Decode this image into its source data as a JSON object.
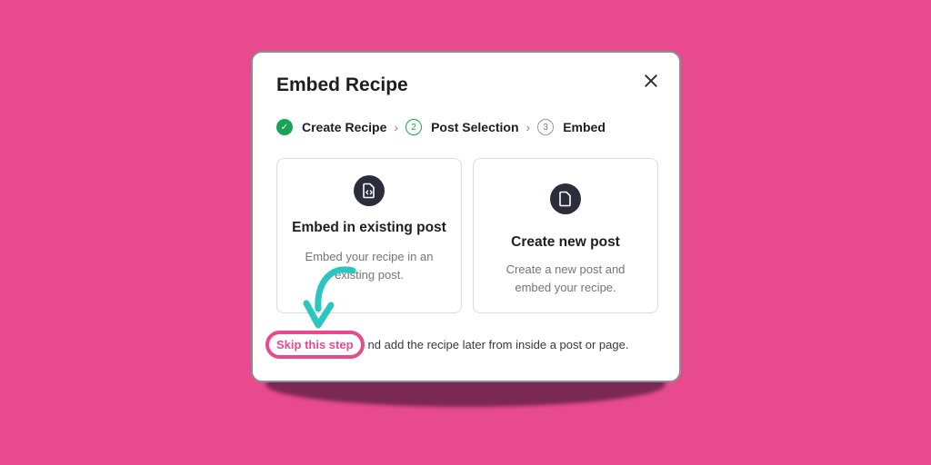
{
  "modal": {
    "title": "Embed Recipe"
  },
  "steps": [
    {
      "label": "Create Recipe",
      "state": "done",
      "number": "✓"
    },
    {
      "label": "Post Selection",
      "state": "active",
      "number": "2"
    },
    {
      "label": "Embed",
      "state": "inactive",
      "number": "3"
    }
  ],
  "separator": "›",
  "cards": {
    "existing": {
      "title": "Embed in existing post",
      "description": "Embed your recipe in an existing post."
    },
    "new_post": {
      "title": "Create new post",
      "description": "Create a new post and embed your recipe."
    }
  },
  "footer": {
    "skip_label": "Skip this step",
    "rest_text": "nd add the recipe later from inside a post or page."
  },
  "colors": {
    "background": "#e84a8e",
    "accent_green": "#1aa357",
    "highlight_pink": "#e84a8e",
    "arrow_teal": "#2cc6c0"
  },
  "icons": {
    "close": "close-icon",
    "step_done": "check-icon",
    "card_existing": "file-code-icon",
    "card_new": "file-icon",
    "annotation": "curved-arrow-icon"
  }
}
